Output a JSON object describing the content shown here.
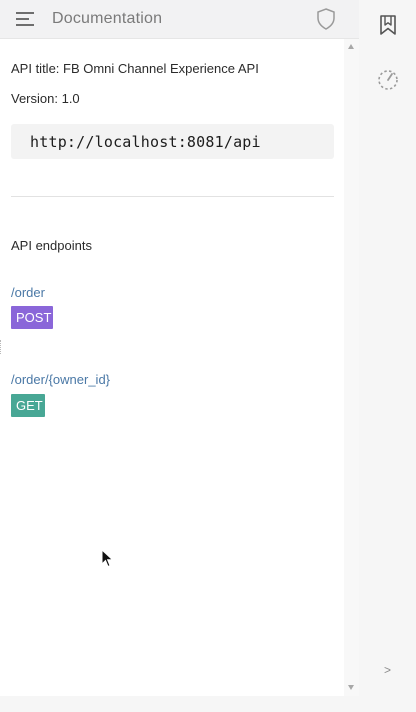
{
  "header": {
    "title": "Documentation",
    "icons": {
      "menu": "hamburger-menu-icon",
      "security": "shield-icon"
    }
  },
  "api": {
    "title_line": "API title: FB Omni Channel Experience API",
    "version_line": "Version: 1.0",
    "base_url": "http://localhost:8081/api"
  },
  "endpoints_heading": "API endpoints",
  "endpoints": [
    {
      "path": "/order",
      "method": "POST",
      "color": "#8a66d9"
    },
    {
      "path": "/order/{owner_id}",
      "method": "GET",
      "color": "#48a795"
    }
  ],
  "rail": {
    "icons": [
      "book-bookmark-icon",
      "dotted-gauge-icon"
    ],
    "expand_label": ">"
  },
  "colors": {
    "link": "#4a78a6",
    "post_badge": "#8a66d9",
    "get_badge": "#48a795",
    "header_bg": "#f2f2f3"
  }
}
